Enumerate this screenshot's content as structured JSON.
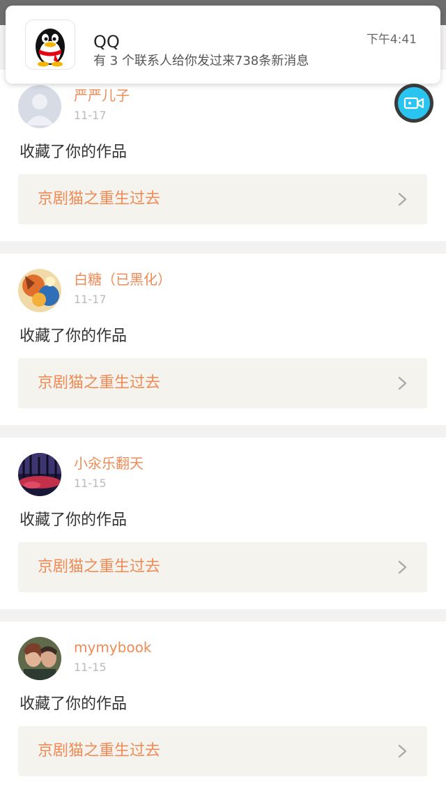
{
  "notification": {
    "app": "QQ",
    "message": "有 3 个联系人给你发过来738条新消息",
    "time": "下午4:41"
  },
  "colors": {
    "accent": "#ef8b56",
    "work_bg": "#f4f3ee",
    "camera": "#29c4f0"
  },
  "feed": [
    {
      "name": "严严儿子",
      "date": "11-17",
      "action": "收藏了你的作品",
      "work": "京剧猫之重生过去",
      "avatar": "default-avatar-icon"
    },
    {
      "name": "白糖（已黑化）",
      "date": "11-17",
      "action": "收藏了你的作品",
      "work": "京剧猫之重生过去",
      "avatar": "cartoon-avatar"
    },
    {
      "name": "小汆乐翻天",
      "date": "11-15",
      "action": "收藏了你的作品",
      "work": "京剧猫之重生过去",
      "avatar": "forest-avatar"
    },
    {
      "name": "mymybook",
      "date": "11-15",
      "action": "收藏了你的作品",
      "work": "京剧猫之重生过去",
      "avatar": "couple-photo-avatar"
    }
  ]
}
